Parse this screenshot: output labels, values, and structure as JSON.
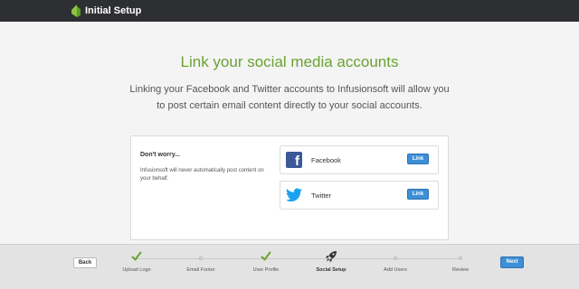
{
  "topbar": {
    "title": "Initial Setup",
    "logo_icon": "infusionsoft-leaf-icon"
  },
  "main": {
    "headline": "Link your social media accounts",
    "subtext": "Linking your Facebook and Twitter accounts to Infusionsoft will allow you to post certain email content directly to your social accounts."
  },
  "card": {
    "title": "Don't worry...",
    "body": "Infusionsoft will never automatically post content on your behalf.",
    "accounts": [
      {
        "name": "Facebook",
        "icon": "facebook-icon",
        "button": "Link",
        "color": "#3b5998"
      },
      {
        "name": "Twitter",
        "icon": "twitter-icon",
        "button": "Link",
        "color": "#1da1f2"
      }
    ]
  },
  "footer": {
    "back_label": "Back",
    "next_label": "Next",
    "steps": [
      {
        "label": "Upload Logo",
        "status": "complete"
      },
      {
        "label": "Email Footer",
        "status": "pending"
      },
      {
        "label": "User Profile",
        "status": "complete"
      },
      {
        "label": "Social Setup",
        "status": "current"
      },
      {
        "label": "Add Users",
        "status": "pending"
      },
      {
        "label": "Review",
        "status": "pending"
      }
    ]
  },
  "colors": {
    "accent_green": "#6aa233",
    "button_blue": "#3d8fd6",
    "topbar": "#2e2f33"
  }
}
